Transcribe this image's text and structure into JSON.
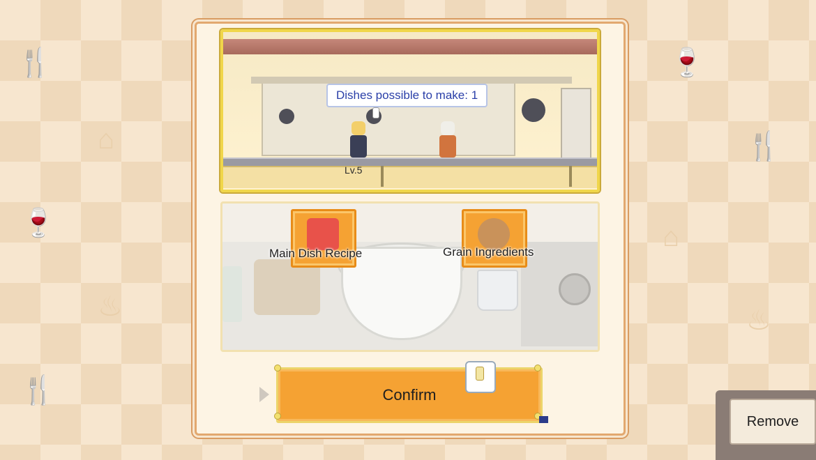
{
  "scene": {
    "speech_bubble": "Dishes possible to make: 1",
    "chef_level": "Lv.5"
  },
  "ingredients": {
    "slots": [
      {
        "label": "Main Dish Recipe",
        "icon": "recipe-book-icon"
      },
      {
        "label": "Grain Ingredients",
        "icon": "grain-bowl-icon"
      }
    ]
  },
  "actions": {
    "confirm_label": "Confirm",
    "remove_label": "Remove"
  },
  "colors": {
    "accent_orange": "#f5a233",
    "scene_border": "#f0d64a",
    "speech_text": "#2a3fa8",
    "panel_bg": "#fdf4e4"
  }
}
